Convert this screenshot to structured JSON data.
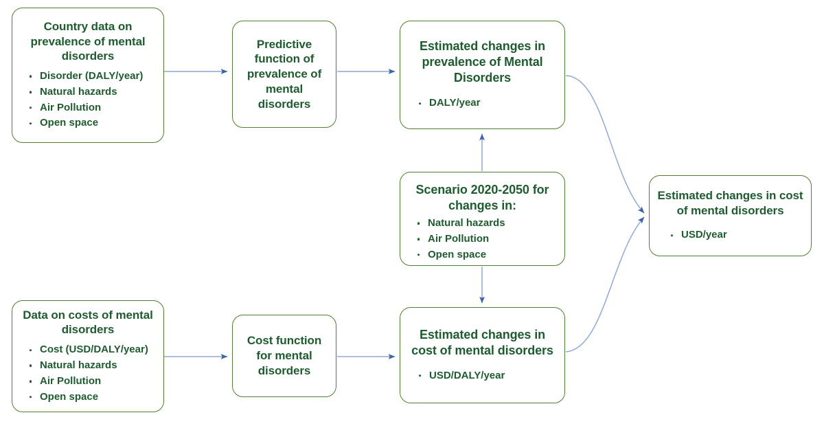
{
  "diagram": {
    "accent_border_color": "#4f7e2e",
    "text_color": "#1e5c2f",
    "connector_color": "#5b7fc4",
    "background_color": "#ffffff",
    "nodes": {
      "country_data": {
        "title": "Country data on prevalence of mental disorders",
        "bullets": [
          "Disorder (DALY/year)",
          "Natural hazards",
          "Air Pollution",
          "Open space"
        ]
      },
      "predictive_function": {
        "title": "Predictive function of prevalence of mental disorders",
        "bullets": []
      },
      "estimated_prevalence": {
        "title": "Estimated changes in prevalence of Mental Disorders",
        "bullets": [
          "DALY/year"
        ]
      },
      "scenario": {
        "title": "Scenario 2020-2050 for changes in:",
        "bullets": [
          "Natural hazards",
          "Air Pollution",
          "Open space"
        ]
      },
      "estimated_cost_final": {
        "title": "Estimated changes in cost of mental disorders",
        "bullets": [
          "USD/year"
        ]
      },
      "cost_data": {
        "title": "Data on costs of mental disorders",
        "bullets": [
          "Cost (USD/DALY/year)",
          "Natural hazards",
          "Air Pollution",
          "Open space"
        ]
      },
      "cost_function": {
        "title": "Cost function for mental disorders",
        "bullets": []
      },
      "estimated_cost_mid": {
        "title": "Estimated changes in cost of mental disorders",
        "bullets": [
          "USD/DALY/year"
        ]
      }
    },
    "edges": [
      {
        "name": "country-data-to-predictive-function",
        "from": "country_data",
        "to": "predictive_function",
        "style": "straight-arrow"
      },
      {
        "name": "predictive-function-to-estimated-prevalence",
        "from": "predictive_function",
        "to": "estimated_prevalence",
        "style": "straight-arrow"
      },
      {
        "name": "scenario-to-estimated-prevalence",
        "from": "scenario",
        "to": "estimated_prevalence",
        "style": "straight-arrow-up"
      },
      {
        "name": "scenario-to-estimated-cost-mid",
        "from": "scenario",
        "to": "estimated_cost_mid",
        "style": "straight-arrow-down"
      },
      {
        "name": "cost-data-to-cost-function",
        "from": "cost_data",
        "to": "cost_function",
        "style": "straight-arrow"
      },
      {
        "name": "cost-function-to-estimated-cost-mid",
        "from": "cost_function",
        "to": "estimated_cost_mid",
        "style": "straight-arrow"
      },
      {
        "name": "estimated-prevalence-to-estimated-cost-final",
        "from": "estimated_prevalence",
        "to": "estimated_cost_final",
        "style": "curved-arrow"
      },
      {
        "name": "estimated-cost-mid-to-estimated-cost-final",
        "from": "estimated_cost_mid",
        "to": "estimated_cost_final",
        "style": "curved-arrow"
      }
    ]
  }
}
